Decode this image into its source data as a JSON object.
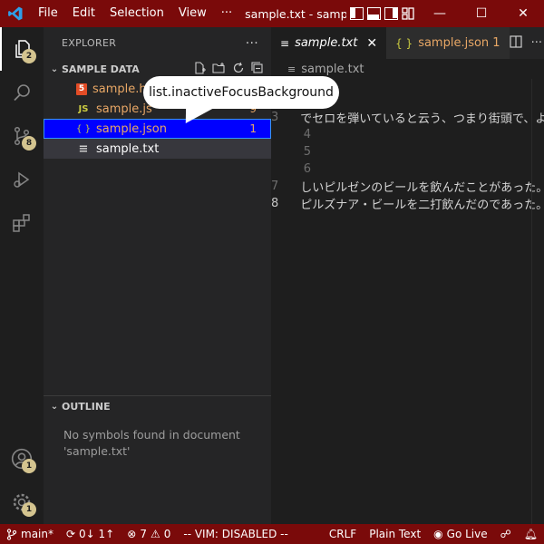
{
  "titlebar": {
    "menu": [
      "File",
      "Edit",
      "Selection",
      "View",
      "···"
    ],
    "window_title": "sample.txt - sample data",
    "controls": {
      "minimize": "—",
      "maximize": "☐",
      "close": "✕"
    }
  },
  "activitybar": {
    "explorer_badge": "2",
    "scm_badge": "8",
    "accounts_badge": "1",
    "settings_badge": "1"
  },
  "sidebar": {
    "title": "EXPLORER",
    "more": "···",
    "folder": "SAMPLE DATA",
    "files": [
      {
        "name": "sample.html",
        "icon": "5",
        "color": "#e37933",
        "count": ""
      },
      {
        "name": "sample.js",
        "icon": "JS",
        "color": "#cbcb41",
        "count": "9"
      },
      {
        "name": "sample.json",
        "icon": "{ }",
        "color": "#cbcb41",
        "count": "1"
      },
      {
        "name": "sample.txt",
        "icon": "≡",
        "color": "#cccccc",
        "count": ""
      }
    ],
    "outline_title": "OUTLINE",
    "outline_message": "No symbols found in document 'sample.txt'"
  },
  "tooltip": {
    "text": "list.inactiveFocusBackground"
  },
  "editor": {
    "tabs": [
      {
        "label": "sample.txt",
        "active": true
      },
      {
        "label": "sample.json 1",
        "active": false
      }
    ],
    "breadcrumb": "sample.txt",
    "lines": [
      {
        "num": "3",
        "text": "でセロを弾いていると云う、つまり街頭で、よく"
      },
      {
        "num": "4",
        "text": ""
      },
      {
        "num": "5",
        "text": ""
      },
      {
        "num": "6",
        "text": ""
      },
      {
        "num": "7",
        "text": "しいピルゼンのビールを飲んだことがあった。"
      },
      {
        "num": "8",
        "text": "ピルズナア・ビールを二打飲んだのであった。"
      }
    ]
  },
  "statusbar": {
    "branch": "main*",
    "sync": "0↓ 1↑",
    "errors": "7",
    "warnings": "0",
    "vim": "-- VIM: DISABLED --",
    "eol": "CRLF",
    "language": "Plain Text",
    "golive": "Go Live"
  },
  "colors": {
    "titlebar": "#7a0a0a",
    "statusbar": "#7a0a0a",
    "focus_row": "#0000ff",
    "accent": "#007acc"
  }
}
